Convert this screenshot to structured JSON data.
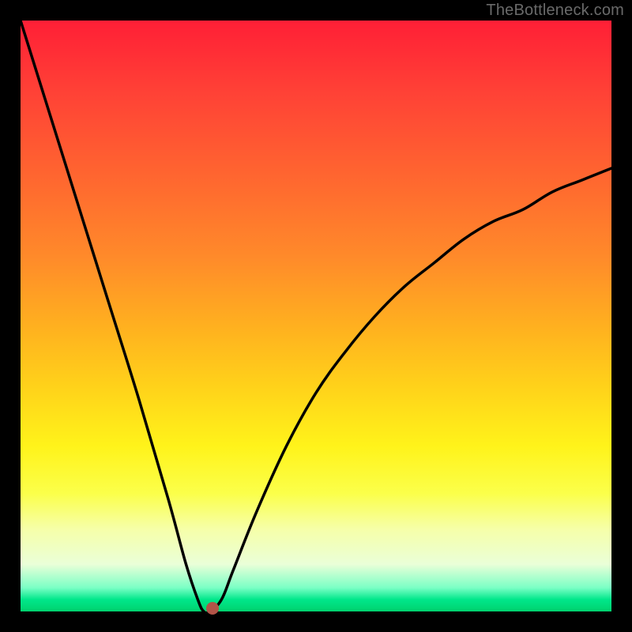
{
  "attribution": "TheBottleneck.com",
  "colors": {
    "page_bg": "#000000",
    "curve_stroke": "#000000",
    "dot_fill": "#b25448",
    "attribution_text": "#6a6a6a",
    "gradient_top": "#ff1f36",
    "gradient_bottom": "#00d16e"
  },
  "chart_data": {
    "type": "line",
    "title": "",
    "xlabel": "",
    "ylabel": "",
    "xlim": [
      0,
      100
    ],
    "ylim": [
      0,
      100
    ],
    "grid": false,
    "legend": false,
    "annotations": [],
    "series": [
      {
        "name": "curve",
        "x": [
          0,
          5,
          10,
          15,
          20,
          25,
          28,
          30,
          31,
          32,
          34,
          36,
          40,
          45,
          50,
          55,
          60,
          65,
          70,
          75,
          80,
          85,
          90,
          95,
          100
        ],
        "values": [
          100,
          84,
          68,
          52,
          36,
          19,
          8,
          2,
          0,
          0,
          2,
          7,
          17,
          28,
          37,
          44,
          50,
          55,
          59,
          63,
          66,
          68,
          71,
          73,
          75
        ]
      }
    ],
    "marker": {
      "x": 32.5,
      "y": 0.5
    }
  }
}
